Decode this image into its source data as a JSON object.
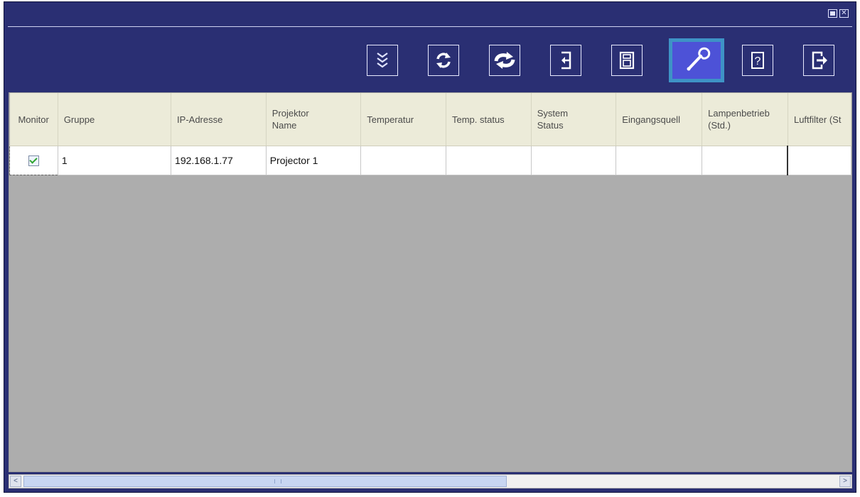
{
  "window": {
    "controls": {
      "minimize_icon": "minimize-icon",
      "close_icon": "close-icon"
    }
  },
  "toolbar": {
    "buttons": [
      {
        "id": "collapse",
        "icon": "triple-chevron-down-icon"
      },
      {
        "id": "refresh",
        "icon": "refresh-icon"
      },
      {
        "id": "sync",
        "icon": "sync-icon"
      },
      {
        "id": "import",
        "icon": "import-icon"
      },
      {
        "id": "save",
        "icon": "save-icon"
      },
      {
        "id": "settings",
        "icon": "wrench-icon",
        "active": true
      },
      {
        "id": "help",
        "icon": "help-icon",
        "glyph": "?"
      },
      {
        "id": "exit",
        "icon": "exit-icon"
      }
    ]
  },
  "table": {
    "headers": [
      "Monitor",
      "Gruppe",
      "IP-Adresse",
      "Projektor\nName",
      "Temperatur",
      "Temp. status",
      "System\nStatus",
      "Eingangsquell",
      "Lampenbetrieb\n(Std.)",
      "Luftfilter (St"
    ],
    "rows": [
      {
        "monitor": true,
        "gruppe": "1",
        "ip": "192.168.1.77",
        "name": "Projector 1",
        "temperatur": "",
        "temp_status": "",
        "system_status": "",
        "eingangsquelle": "",
        "lampenbetrieb": "",
        "luftfilter": ""
      }
    ]
  },
  "scrollbar": {
    "left_arrow": "<",
    "right_arrow": ">"
  }
}
